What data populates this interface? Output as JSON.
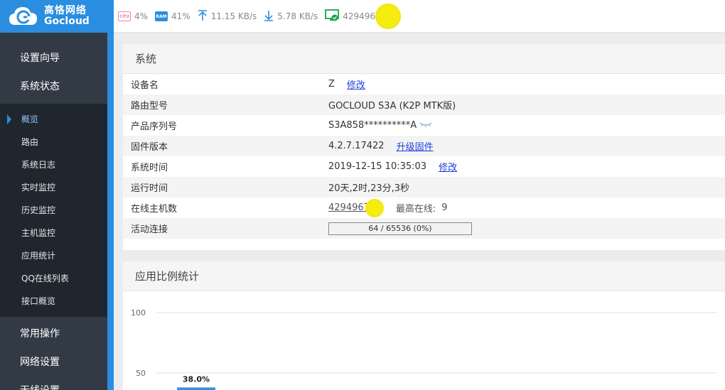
{
  "brand": {
    "name_cn": "高恪网络",
    "name_en": "Gocloud"
  },
  "topbar": {
    "cpu": {
      "icon": "CPU",
      "value": "4%"
    },
    "ram": {
      "icon": "RAM",
      "value": "41%"
    },
    "upload": "11.15 KB/s",
    "download": "5.78 KB/s",
    "hosts": "4294967"
  },
  "sidebar": {
    "top_items": [
      "设置向导",
      "系统状态"
    ],
    "sub_items": [
      "概览",
      "路由",
      "系统日志",
      "实时监控",
      "历史监控",
      "主机监控",
      "应用统计",
      "QQ在线列表",
      "接口概览"
    ],
    "active_index": 0,
    "bottom_items": [
      "常用操作",
      "网络设置",
      "无线设置"
    ]
  },
  "system": {
    "title": "系统",
    "device_name": {
      "label": "设备名",
      "value": "Z",
      "link": "修改"
    },
    "model": {
      "label": "路由型号",
      "value": "GOCLOUD S3A (K2P MTK版)"
    },
    "serial": {
      "label": "产品序列号",
      "value": "S3A858**********A"
    },
    "firmware": {
      "label": "固件版本",
      "value": "4.2.7.17422",
      "link": "升级固件"
    },
    "time": {
      "label": "系统时间",
      "value": "2019-12-15 10:35:03",
      "link": "修改"
    },
    "uptime": {
      "label": "运行时间",
      "value": "20天,2时,23分,3秒"
    },
    "online_hosts": {
      "label": "在线主机数",
      "value": "4294967",
      "max_label": "最高在线:",
      "max_value": "9"
    },
    "connections": {
      "label": "活动连接",
      "value": "64 / 65536 (0%)",
      "fraction": 0.001
    }
  },
  "app_stats": {
    "title": "应用比例统计"
  },
  "chart_data": {
    "type": "bar",
    "title": "",
    "ylim": [
      0,
      100
    ],
    "y_ticks": [
      "100",
      "50"
    ],
    "categories": [
      ""
    ],
    "values": [
      38.0
    ],
    "data_labels": [
      "38.0%"
    ],
    "grid": true,
    "colors": {
      "bar": "#3a8fd6",
      "grid": "#e2e2e2"
    }
  }
}
